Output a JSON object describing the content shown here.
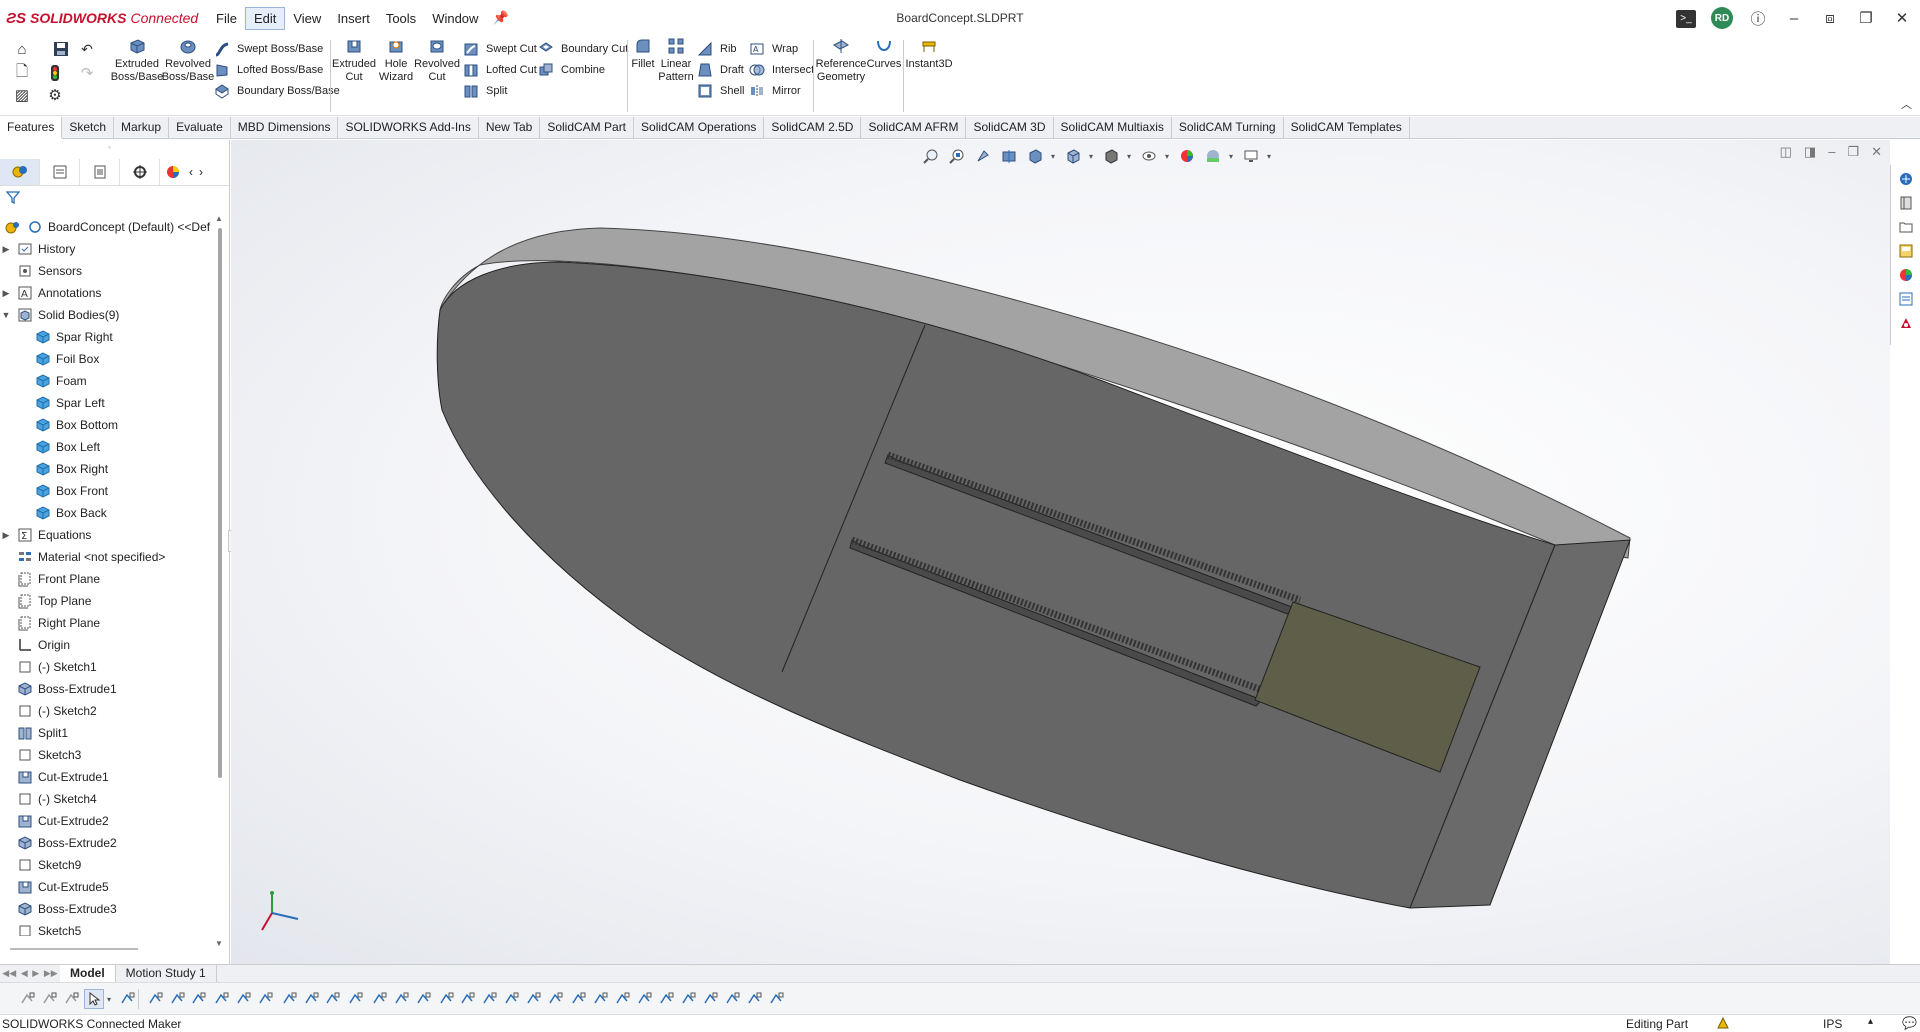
{
  "app": {
    "brand": "SOLIDWORKS",
    "brand_suffix": "Connected",
    "document_title": "BoardConcept.SLDPRT",
    "user_initials": "RD"
  },
  "menu": [
    "File",
    "Edit",
    "View",
    "Insert",
    "Tools",
    "Window"
  ],
  "ribbon": {
    "extruded_boss": "Extruded Boss/Base",
    "revolved_boss": "Revolved Boss/Base",
    "swept_boss": "Swept Boss/Base",
    "lofted_boss": "Lofted Boss/Base",
    "boundary_boss": "Boundary Boss/Base",
    "extruded_cut": "Extruded Cut",
    "hole_wizard": "Hole Wizard",
    "revolved_cut": "Revolved Cut",
    "swept_cut": "Swept Cut",
    "lofted_cut": "Lofted Cut",
    "boundary_cut": "Boundary Cut",
    "split": "Split",
    "combine": "Combine",
    "fillet": "Fillet",
    "linear_pattern": "Linear Pattern",
    "rib": "Rib",
    "draft": "Draft",
    "shell": "Shell",
    "wrap": "Wrap",
    "intersect": "Intersect",
    "mirror": "Mirror",
    "reference_geometry": "Reference Geometry",
    "curves": "Curves",
    "instant3d": "Instant3D"
  },
  "command_tabs": [
    "Features",
    "Sketch",
    "Markup",
    "Evaluate",
    "MBD Dimensions",
    "SOLIDWORKS Add-Ins",
    "New Tab",
    "SolidCAM Part",
    "SolidCAM Operations",
    "SolidCAM 2.5D",
    "SolidCAM AFRM",
    "SolidCAM 3D",
    "SolidCAM Multiaxis",
    "SolidCAM Turning",
    "SolidCAM Templates"
  ],
  "tree": {
    "root": "BoardConcept (Default) <<Def",
    "items": [
      {
        "label": "History",
        "icon": "history-folder-icon",
        "expand": "▶",
        "indent": 0
      },
      {
        "label": "Sensors",
        "icon": "sensors-icon",
        "expand": "",
        "indent": 0
      },
      {
        "label": "Annotations",
        "icon": "annotations-icon",
        "expand": "▶",
        "indent": 0
      },
      {
        "label": "Solid Bodies(9)",
        "icon": "solid-bodies-icon",
        "expand": "▼",
        "indent": 0
      },
      {
        "label": "Spar Right",
        "icon": "body-icon",
        "expand": "",
        "indent": 1
      },
      {
        "label": "Foil Box",
        "icon": "body-icon",
        "expand": "",
        "indent": 1
      },
      {
        "label": "Foam",
        "icon": "body-icon",
        "expand": "",
        "indent": 1
      },
      {
        "label": "Spar Left",
        "icon": "body-icon",
        "expand": "",
        "indent": 1
      },
      {
        "label": "Box Bottom",
        "icon": "body-icon",
        "expand": "",
        "indent": 1
      },
      {
        "label": "Box Left",
        "icon": "body-icon",
        "expand": "",
        "indent": 1
      },
      {
        "label": "Box Right",
        "icon": "body-icon",
        "expand": "",
        "indent": 1
      },
      {
        "label": "Box Front",
        "icon": "body-icon",
        "expand": "",
        "indent": 1
      },
      {
        "label": "Box Back",
        "icon": "body-icon",
        "expand": "",
        "indent": 1
      },
      {
        "label": "Equations",
        "icon": "equations-icon",
        "expand": "▶",
        "indent": 0
      },
      {
        "label": "Material <not specified>",
        "icon": "material-icon",
        "expand": "",
        "indent": 0
      },
      {
        "label": "Front Plane",
        "icon": "plane-icon",
        "expand": "",
        "indent": 0
      },
      {
        "label": "Top Plane",
        "icon": "plane-icon",
        "expand": "",
        "indent": 0
      },
      {
        "label": "Right Plane",
        "icon": "plane-icon",
        "expand": "",
        "indent": 0
      },
      {
        "label": "Origin",
        "icon": "origin-icon",
        "expand": "",
        "indent": 0
      },
      {
        "label": "(-) Sketch1",
        "icon": "sketch-icon",
        "expand": "",
        "indent": 0
      },
      {
        "label": "Boss-Extrude1",
        "icon": "boss-extrude-icon",
        "expand": "",
        "indent": 0
      },
      {
        "label": "(-) Sketch2",
        "icon": "sketch-icon",
        "expand": "",
        "indent": 0
      },
      {
        "label": "Split1",
        "icon": "split-icon",
        "expand": "",
        "indent": 0
      },
      {
        "label": "Sketch3",
        "icon": "sketch-icon",
        "expand": "",
        "indent": 0
      },
      {
        "label": "Cut-Extrude1",
        "icon": "cut-extrude-icon",
        "expand": "",
        "indent": 0
      },
      {
        "label": "(-) Sketch4",
        "icon": "sketch-icon",
        "expand": "",
        "indent": 0
      },
      {
        "label": "Cut-Extrude2",
        "icon": "cut-extrude-icon",
        "expand": "",
        "indent": 0
      },
      {
        "label": "Boss-Extrude2",
        "icon": "boss-extrude-icon",
        "expand": "",
        "indent": 0
      },
      {
        "label": "Sketch9",
        "icon": "sketch-icon",
        "expand": "",
        "indent": 0
      },
      {
        "label": "Cut-Extrude5",
        "icon": "cut-extrude-icon",
        "expand": "",
        "indent": 0
      },
      {
        "label": "Boss-Extrude3",
        "icon": "boss-extrude-icon",
        "expand": "",
        "indent": 0
      },
      {
        "label": "Sketch5",
        "icon": "sketch-icon",
        "expand": "",
        "indent": 0
      }
    ]
  },
  "bottom_tabs": [
    "Model",
    "Motion Study 1"
  ],
  "status": {
    "left": "SOLIDWORKS Connected Maker",
    "mode": "Editing Part",
    "units": "IPS"
  },
  "colors": {
    "brand_red": "#c8102e",
    "model_gray": "#666666",
    "model_top": "#a3a3a3",
    "foil_box": "#5e5e49",
    "accent_blue": "#2a6ebb"
  }
}
